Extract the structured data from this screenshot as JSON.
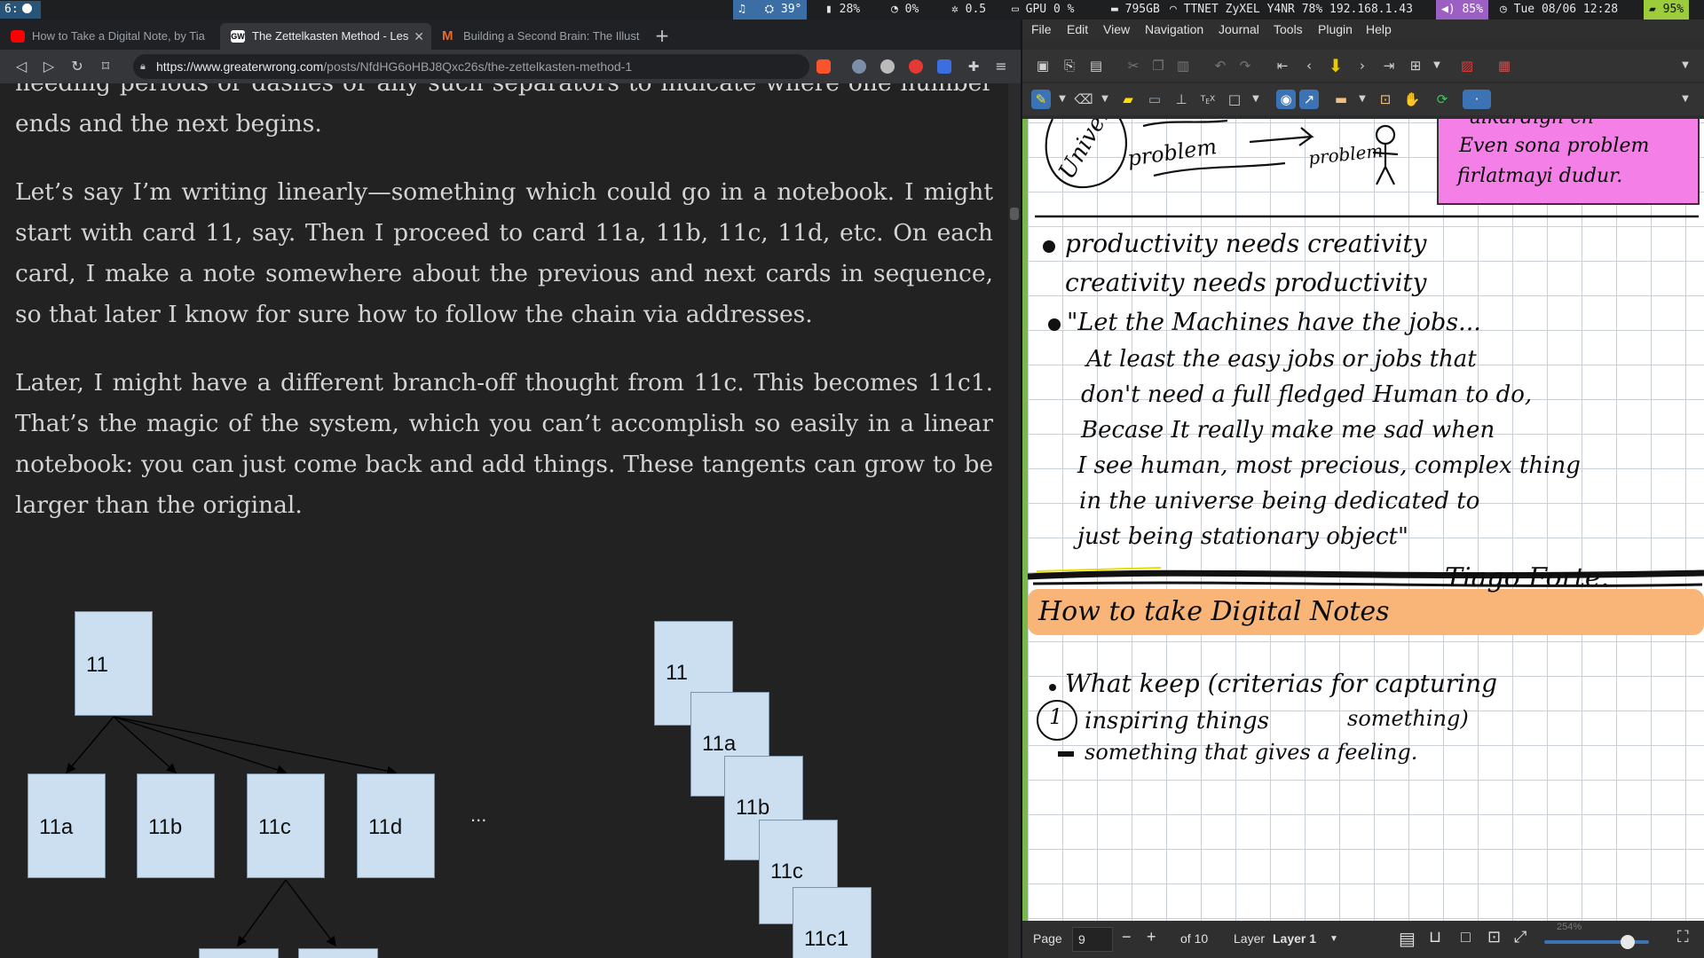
{
  "statusbar": {
    "workspace": "6:",
    "music_temp": "39°",
    "battery_small": "28%",
    "cpu": "0%",
    "load": "0.5",
    "gpu": "GPU  0 %",
    "disk": "795GB",
    "wifi": "TTNET ZyXEL Y4NR 78% 192.168.1.43",
    "volume": "85%",
    "datetime": "Tue 08/06 12:28",
    "battery": "95%"
  },
  "browser": {
    "tabs": [
      {
        "label": "How to Take a Digital Note, by Tia",
        "active": false,
        "favicon_color": "#ff0000"
      },
      {
        "label": "The Zettelkasten Method - Les",
        "active": true,
        "favicon_color": "#ffffff",
        "favicon_text": "GW"
      },
      {
        "label": "Building a Second Brain: The Illust",
        "active": false,
        "favicon_color": "#e66a2c",
        "favicon_text": "M"
      }
    ],
    "new_tab": "+",
    "url_host": "https://www.greaterwrong.com",
    "url_path": "/posts/NfdHG6oHBJ8Qxc26s/the-zettelkasten-method-1",
    "paragraphs": [
      "needing periods or dashes or any such separators to indicate where one number ends and the next begins.",
      "Let’s say I’m writing linearly—something which could go in a notebook. I might start with card 11, say. Then I proceed to card 11a, 11b, 11c, 11d, etc. On each card, I make a note somewhere about the previous and next cards in sequence, so that later I know for sure how to follow the chain via addresses.",
      "Later, I might have a different branch-off thought from 11c. This becomes 11c1. That’s the magic of the system, which you can’t accomplish so easily in a linear notebook: you can just come back and add things. These tangents can grow to be larger than the original."
    ],
    "diagram_tree": {
      "root": "11",
      "children": [
        "11a",
        "11b",
        "11c",
        "11d"
      ],
      "ellipsis": "..."
    },
    "diagram_stack": [
      "11",
      "11a",
      "11b",
      "11c",
      "11c1"
    ]
  },
  "xournal": {
    "menu": [
      "File",
      "Edit",
      "View",
      "Navigation",
      "Journal",
      "Tools",
      "Plugin",
      "Help"
    ],
    "page_label": "Page",
    "page_value": "9",
    "page_of": "of 10",
    "layer_label": "Layer",
    "layer_value": "Layer 1",
    "zoom": "254%",
    "notes": {
      "sketch_words": [
        "Univer",
        "problem",
        "problem"
      ],
      "pink_box": [
        "alkardigh cn",
        "Even sona problem",
        "firlatmayi dudur."
      ],
      "bullet1": [
        "productivity   needs  creativity",
        "creativity   needs   productivity"
      ],
      "quote": [
        "\"Let  the  Machines  have  the  jobs...",
        "At least  the easy  jobs  or  jobs  that",
        "don't  need   a  full  fledged  Human  to  do,",
        "Becase  It  really  make  me  sad  when",
        "I see  human,  most  precious, complex  thing",
        "in  the  universe  being  dedicated  to",
        "just  being  stationary  object\""
      ],
      "author": "Tiago  Forte.",
      "heading": "How  to  take  Digital  Notes",
      "bullet2": "What  keep   (criterias  for  capturing",
      "bullet2b": "something)",
      "item1": "inspiring  things",
      "item1_num": "1",
      "item2": "something  that  gives  a  feeling."
    }
  }
}
